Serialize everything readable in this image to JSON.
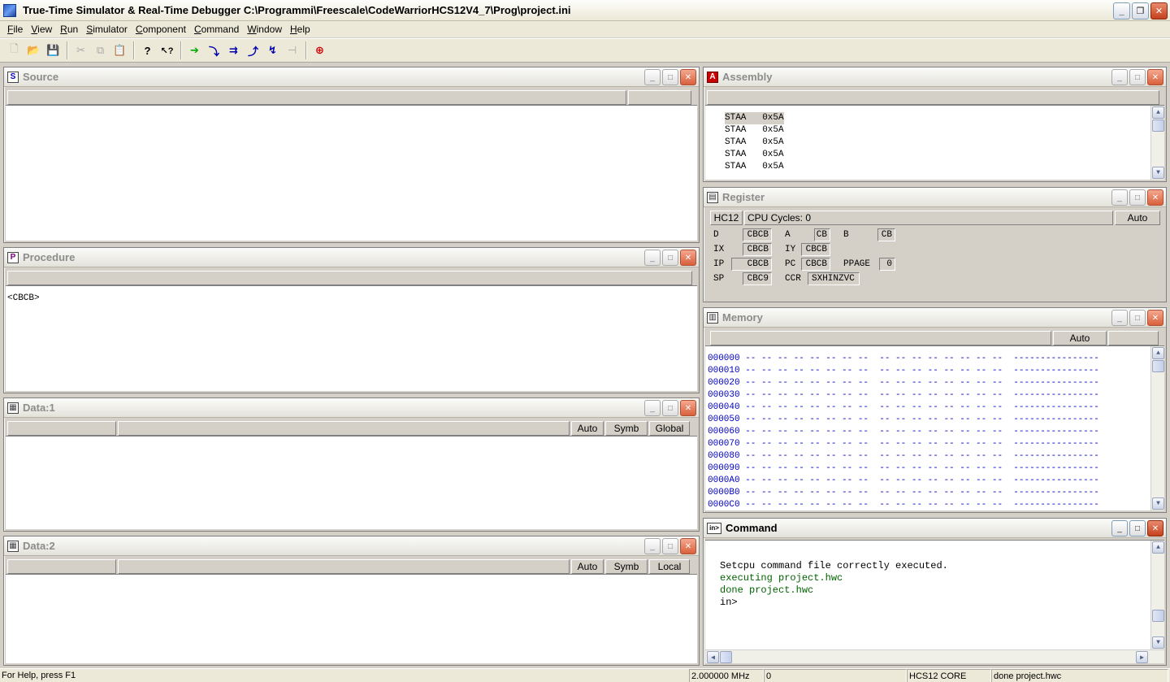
{
  "window": {
    "title": "True-Time Simulator & Real-Time Debugger   C:\\Programmi\\Freescale\\CodeWarriorHCS12V4_7\\Prog\\project.ini",
    "minimize": "_",
    "restore": "❐",
    "close": "✕"
  },
  "menu": [
    {
      "label": "File",
      "key": "F",
      "rest": "ile"
    },
    {
      "label": "View",
      "key": "V",
      "rest": "iew"
    },
    {
      "label": "Run",
      "key": "R",
      "rest": "un"
    },
    {
      "label": "Simulator",
      "key": "S",
      "rest": "imulator"
    },
    {
      "label": "Component",
      "key": "C",
      "rest": "omponent"
    },
    {
      "label": "Command",
      "key": "C",
      "rest": "ommand"
    },
    {
      "label": "Window",
      "key": "W",
      "rest": "indow"
    },
    {
      "label": "Help",
      "key": "H",
      "rest": "elp"
    }
  ],
  "toolbar": {
    "new": "🗋",
    "open": "📂",
    "save": "💾",
    "cut": "✂",
    "copy": "⧉",
    "paste": "📋",
    "help": "?",
    "context_help": "↖?",
    "start": "➔",
    "single_step": "⤵",
    "step_over": "⇉",
    "step_out": "⤴",
    "assembly_step": "↯",
    "halt": "⊣",
    "reset": "⊕"
  },
  "panes": {
    "source": {
      "title": "Source",
      "icon": "S"
    },
    "procedure": {
      "title": "Procedure",
      "icon": "P",
      "lines": [
        "<CBCB>"
      ]
    },
    "data1": {
      "title": "Data:1",
      "icon": "▦",
      "mode": "Auto",
      "format": "Symb",
      "scope": "Global"
    },
    "data2": {
      "title": "Data:2",
      "icon": "▦",
      "mode": "Auto",
      "format": "Symb",
      "scope": "Local"
    },
    "assembly": {
      "title": "Assembly",
      "icon": "A",
      "lines": [
        "STAA   0x5A",
        "STAA   0x5A",
        "STAA   0x5A",
        "STAA   0x5A",
        "STAA   0x5A"
      ]
    },
    "register": {
      "title": "Register",
      "icon": "▤",
      "cpu": "HC12",
      "cycles": "CPU Cycles:  0",
      "mode": "Auto",
      "D": "CBCB",
      "A": "CB",
      "B": "CB",
      "IX": "CBCB",
      "IY": "CBCB",
      "IP": "CBCB",
      "PC": "CBCB",
      "PPAGE": "0",
      "SP": "CBC9",
      "CCR": "SXHINZVC"
    },
    "memory": {
      "title": "Memory",
      "icon": "▥",
      "mode": "Auto",
      "rows": [
        "000000 -- -- -- -- -- -- -- --  -- -- -- -- -- -- -- --  ----------------",
        "000010 -- -- -- -- -- -- -- --  -- -- -- -- -- -- -- --  ----------------",
        "000020 -- -- -- -- -- -- -- --  -- -- -- -- -- -- -- --  ----------------",
        "000030 -- -- -- -- -- -- -- --  -- -- -- -- -- -- -- --  ----------------",
        "000040 -- -- -- -- -- -- -- --  -- -- -- -- -- -- -- --  ----------------",
        "000050 -- -- -- -- -- -- -- --  -- -- -- -- -- -- -- --  ----------------",
        "000060 -- -- -- -- -- -- -- --  -- -- -- -- -- -- -- --  ----------------",
        "000070 -- -- -- -- -- -- -- --  -- -- -- -- -- -- -- --  ----------------",
        "000080 -- -- -- -- -- -- -- --  -- -- -- -- -- -- -- --  ----------------",
        "000090 -- -- -- -- -- -- -- --  -- -- -- -- -- -- -- --  ----------------",
        "0000A0 -- -- -- -- -- -- -- --  -- -- -- -- -- -- -- --  ----------------",
        "0000B0 -- -- -- -- -- -- -- --  -- -- -- -- -- -- -- --  ----------------",
        "0000C0 -- -- -- -- -- -- -- --  -- -- -- -- -- -- -- --  ----------------"
      ]
    },
    "command": {
      "title": "Command",
      "icon": "in>",
      "lines": [
        {
          "text": "Setcpu command file correctly executed.",
          "color": "#000000"
        },
        {
          "text": "executing project.hwc",
          "color": "#006400"
        },
        {
          "text": "",
          "color": "#000000"
        },
        {
          "text": "done project.hwc",
          "color": "#006400"
        },
        {
          "text": "",
          "color": "#000000"
        },
        {
          "text": "",
          "color": "#000000"
        },
        {
          "text": "in>",
          "color": "#000000"
        }
      ]
    }
  },
  "status": {
    "help": "For Help, press F1",
    "freq": "2.000000 MHz",
    "cycles": "0",
    "core": "HCS12 CORE",
    "message": "done project.hwc"
  },
  "scroll": {
    "up": "▲",
    "down": "▼",
    "left": "◀",
    "right": "▶"
  }
}
